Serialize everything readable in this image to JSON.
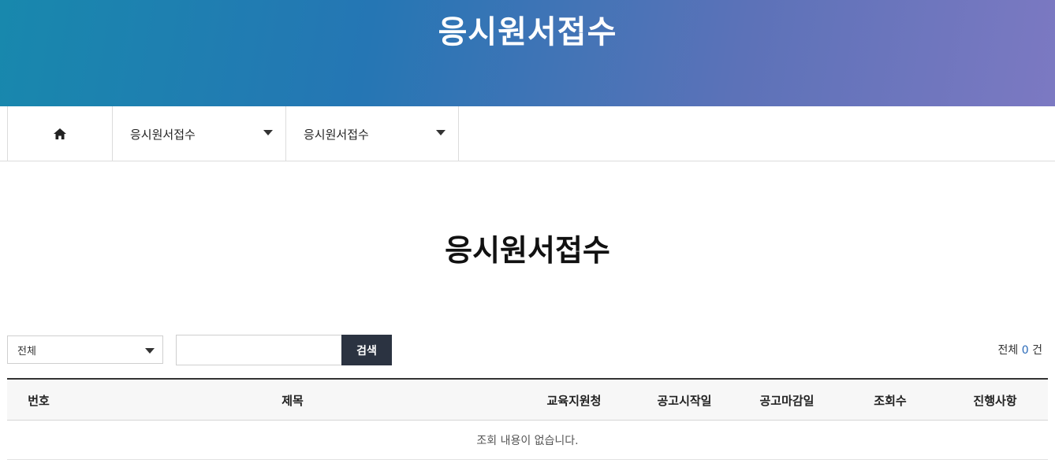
{
  "banner": {
    "title": "응시원서접수"
  },
  "nav": {
    "home_icon": "home-icon",
    "dropdown1": "응시원서접수",
    "dropdown2": "응시원서접수"
  },
  "page": {
    "title": "응시원서접수"
  },
  "filter": {
    "select_value": "전체",
    "search_value": "",
    "search_button": "검색",
    "total_prefix": "전체",
    "total_count": "0",
    "total_suffix": "건"
  },
  "table": {
    "columns": [
      "번호",
      "제목",
      "교육지원청",
      "공고시작일",
      "공고마감일",
      "조회수",
      "진행사항"
    ],
    "empty_message": "조회 내용이 없습니다."
  }
}
